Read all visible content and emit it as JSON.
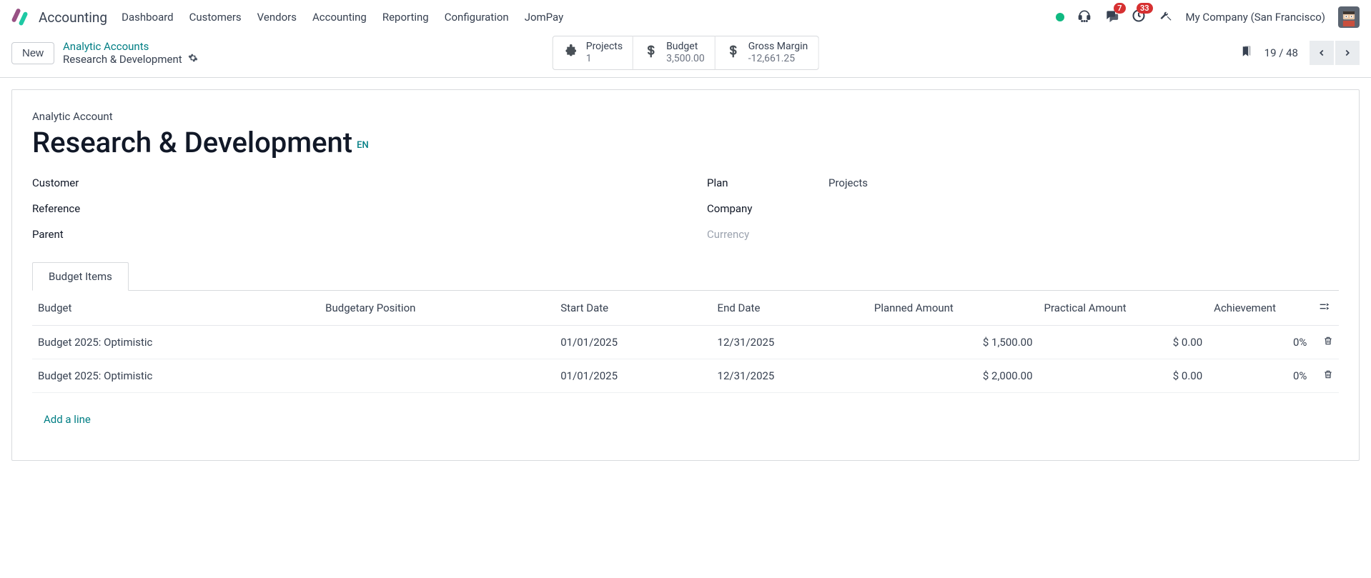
{
  "nav": {
    "app": "Accounting",
    "items": [
      "Dashboard",
      "Customers",
      "Vendors",
      "Accounting",
      "Reporting",
      "Configuration",
      "JomPay"
    ],
    "chat_badge": "7",
    "activity_badge": "33",
    "company": "My Company (San Francisco)"
  },
  "subbar": {
    "new": "New",
    "breadcrumb_top": "Analytic Accounts",
    "breadcrumb_current": "Research & Development",
    "stats": {
      "projects": {
        "label": "Projects",
        "value": "1"
      },
      "budget": {
        "label": "Budget",
        "value": "3,500.00"
      },
      "margin": {
        "label": "Gross Margin",
        "value": "-12,661.25"
      }
    },
    "pager": "19 / 48"
  },
  "form": {
    "title_label": "Analytic Account",
    "title": "Research & Development",
    "lang": "EN",
    "left": {
      "customer": {
        "label": "Customer",
        "value": ""
      },
      "reference": {
        "label": "Reference",
        "value": ""
      },
      "parent": {
        "label": "Parent",
        "value": ""
      }
    },
    "right": {
      "plan": {
        "label": "Plan",
        "value": "Projects"
      },
      "company": {
        "label": "Company",
        "value": ""
      },
      "currency": {
        "label": "Currency",
        "value": ""
      }
    }
  },
  "tabs": {
    "budget_items": "Budget Items"
  },
  "table": {
    "headers": {
      "budget": "Budget",
      "position": "Budgetary Position",
      "start": "Start Date",
      "end": "End Date",
      "planned": "Planned Amount",
      "practical": "Practical Amount",
      "achievement": "Achievement"
    },
    "rows": [
      {
        "budget": "Budget 2025: Optimistic",
        "position": "",
        "start": "01/01/2025",
        "end": "12/31/2025",
        "planned": "$ 1,500.00",
        "practical": "$ 0.00",
        "achievement": "0%"
      },
      {
        "budget": "Budget 2025: Optimistic",
        "position": "",
        "start": "01/01/2025",
        "end": "12/31/2025",
        "planned": "$ 2,000.00",
        "practical": "$ 0.00",
        "achievement": "0%"
      }
    ],
    "add_line": "Add a line"
  }
}
